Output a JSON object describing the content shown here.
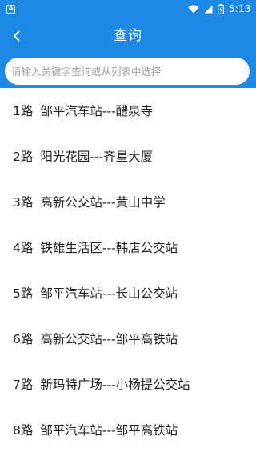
{
  "status_bar": {
    "notification_icon": "A",
    "time": "5:13"
  },
  "app_bar": {
    "title": "查询",
    "back_icon": "chevron-left-icon"
  },
  "search": {
    "placeholder": "请输入关键字查询或从列表中选择",
    "value": ""
  },
  "routes": [
    {
      "number": "1路",
      "name": "邹平汽车站---醴泉寺"
    },
    {
      "number": "2路",
      "name": "阳光花园---齐星大厦"
    },
    {
      "number": "3路",
      "name": "高新公交站---黄山中学"
    },
    {
      "number": "4路",
      "name": "铁雄生活区---韩店公交站"
    },
    {
      "number": "5路",
      "name": "邹平汽车站---长山公交站"
    },
    {
      "number": "6路",
      "name": "高新公交站---邹平高铁站"
    },
    {
      "number": "7路",
      "name": "新玛特广场---小杨提公交站"
    },
    {
      "number": "8路",
      "name": "邹平汽车站---邹平高铁站"
    }
  ],
  "colors": {
    "primary": "#1e88e5",
    "text": "#222222",
    "placeholder": "#9e9e9e"
  }
}
